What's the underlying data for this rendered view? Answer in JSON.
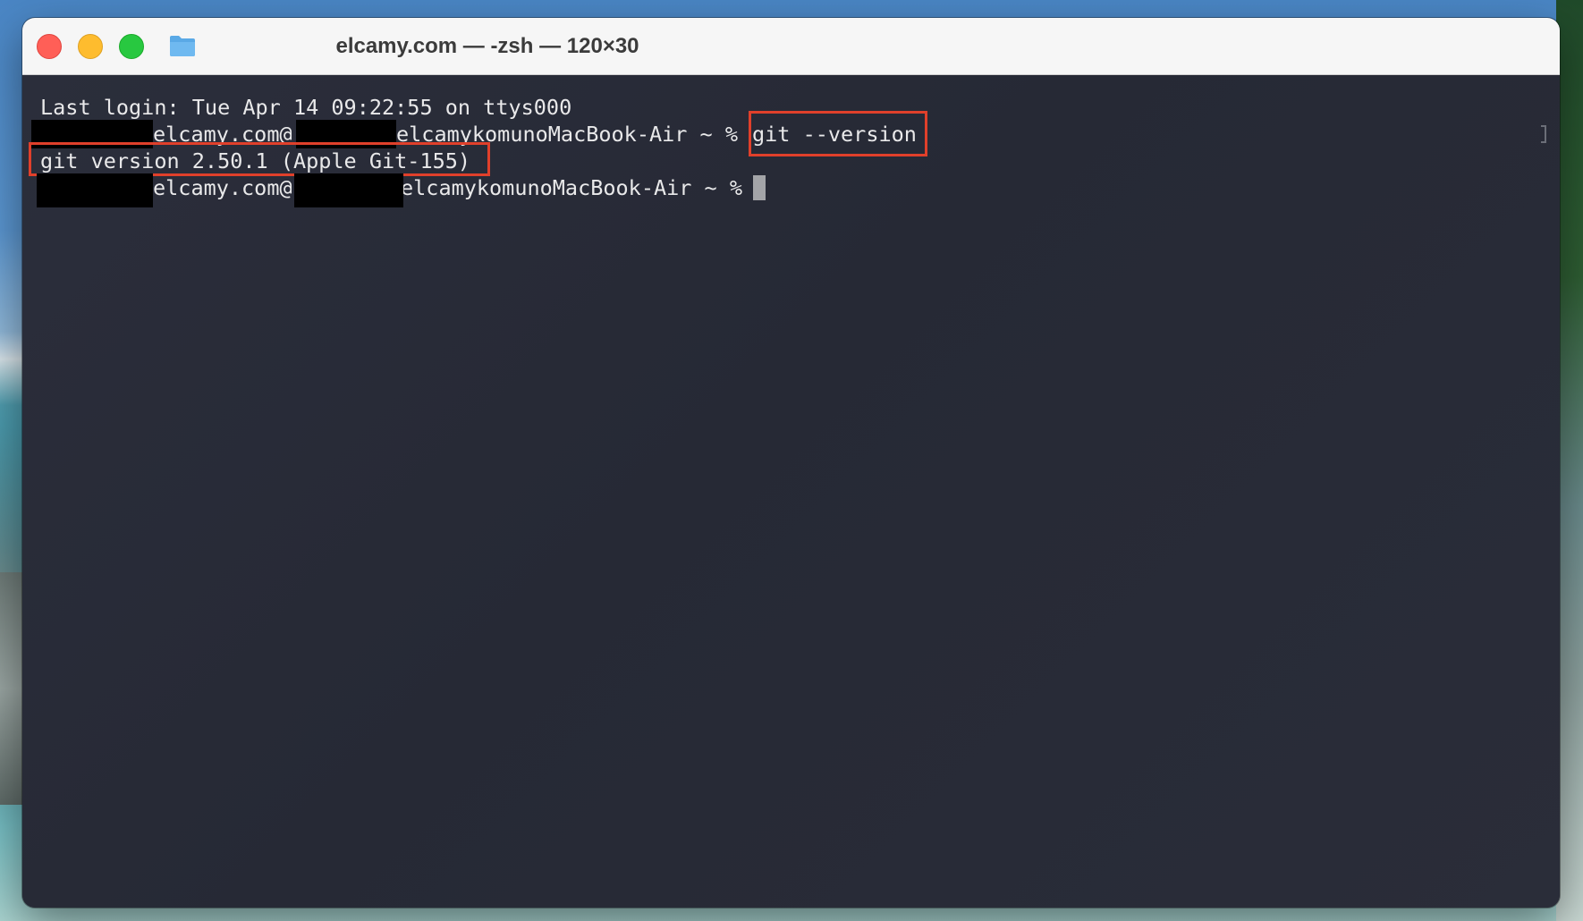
{
  "window": {
    "title": "elcamy.com — -zsh — 120×30"
  },
  "terminal": {
    "last_login": "Last login: Tue Apr 14 09:22:55 on ttys000",
    "prompt_user": "elcamy.com@",
    "prompt_host": "elcamykomunoMacBook-Air ~ %",
    "command": "git --version",
    "output": "git version 2.50.1 (Apple Git-155)"
  },
  "icons": {
    "folder": "folder-icon"
  },
  "colors": {
    "terminal_bg": "#272a36",
    "terminal_text": "#e9e9ea",
    "highlight": "#e0402b",
    "close": "#ff5f57",
    "minimize": "#febc2e",
    "maximize": "#28c840"
  }
}
